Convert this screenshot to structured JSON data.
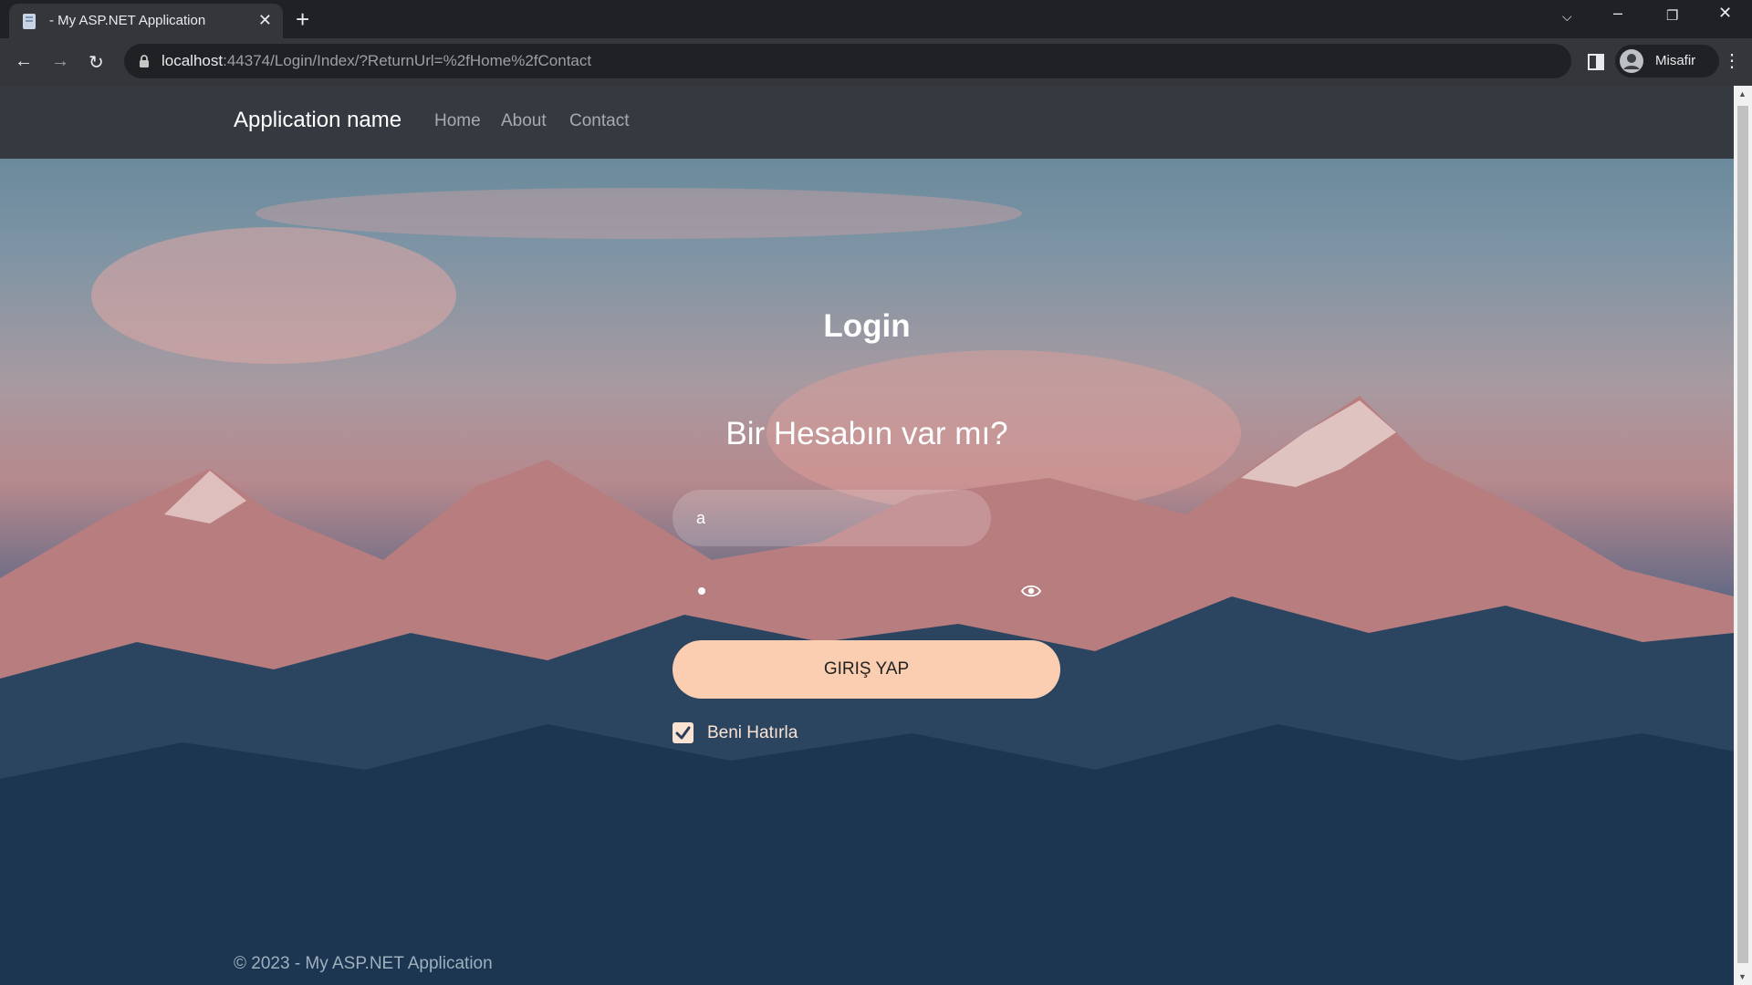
{
  "browser": {
    "tab_title": "- My ASP.NET Application",
    "url_host": "localhost",
    "url_rest": ":44374/Login/Index/?ReturnUrl=%2fHome%2fContact",
    "profile_name": "Misafir"
  },
  "navbar": {
    "brand": "Application name",
    "links": [
      "Home",
      "About",
      "Contact"
    ]
  },
  "login": {
    "title": "Login",
    "subtitle": "Bir Hesabın var mı?",
    "username_value": "a",
    "submit_label": "GIRIŞ YAP",
    "remember_label": "Beni Hatırla",
    "remember_checked": true
  },
  "footer": {
    "text": "© 2023 - My ASP.NET Application"
  },
  "colors": {
    "navbar_bg": "#343a40",
    "button_bg": "#fbceb1",
    "accent": "#fbe3d4"
  }
}
